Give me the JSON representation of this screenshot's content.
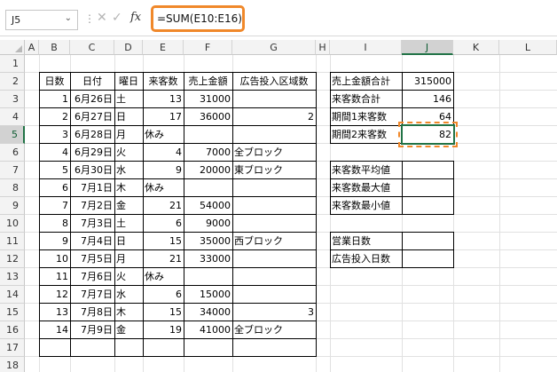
{
  "formula_bar": {
    "name_box": "J5",
    "formula": "=SUM(E10:E16)",
    "fx_label": "fx"
  },
  "columns": [
    "A",
    "B",
    "C",
    "D",
    "E",
    "F",
    "G",
    "H",
    "I",
    "J",
    "K",
    "L"
  ],
  "rows": [
    "1",
    "2",
    "3",
    "4",
    "5",
    "6",
    "7",
    "8",
    "9",
    "10",
    "11",
    "12",
    "13",
    "14",
    "15",
    "16",
    "17",
    "18"
  ],
  "table_headers": {
    "day_num": "日数",
    "date": "日付",
    "weekday": "曜日",
    "visitors": "来客数",
    "sales": "売上金額",
    "ad_area": "広告投入区域数"
  },
  "table_rows": [
    {
      "n": "1",
      "date": "6月26日",
      "wd": "土",
      "visitors": "13",
      "sales": "31000",
      "area": ""
    },
    {
      "n": "2",
      "date": "6月27日",
      "wd": "日",
      "visitors": "17",
      "sales": "36000",
      "area": "2"
    },
    {
      "n": "3",
      "date": "6月28日",
      "wd": "月",
      "visitors": "休み",
      "sales": "",
      "area": ""
    },
    {
      "n": "4",
      "date": "6月29日",
      "wd": "火",
      "visitors": "4",
      "sales": "7000",
      "area": "全ブロック"
    },
    {
      "n": "5",
      "date": "6月30日",
      "wd": "水",
      "visitors": "9",
      "sales": "20000",
      "area": "東ブロック"
    },
    {
      "n": "6",
      "date": "7月1日",
      "wd": "木",
      "visitors": "休み",
      "sales": "",
      "area": ""
    },
    {
      "n": "7",
      "date": "7月2日",
      "wd": "金",
      "visitors": "21",
      "sales": "54000",
      "area": ""
    },
    {
      "n": "8",
      "date": "7月3日",
      "wd": "土",
      "visitors": "6",
      "sales": "9000",
      "area": ""
    },
    {
      "n": "9",
      "date": "7月4日",
      "wd": "日",
      "visitors": "15",
      "sales": "35000",
      "area": "西ブロック"
    },
    {
      "n": "10",
      "date": "7月5日",
      "wd": "月",
      "visitors": "21",
      "sales": "33000",
      "area": ""
    },
    {
      "n": "11",
      "date": "7月6日",
      "wd": "火",
      "visitors": "休み",
      "sales": "",
      "area": ""
    },
    {
      "n": "12",
      "date": "7月7日",
      "wd": "水",
      "visitors": "6",
      "sales": "15000",
      "area": ""
    },
    {
      "n": "13",
      "date": "7月8日",
      "wd": "木",
      "visitors": "15",
      "sales": "34000",
      "area": "3"
    },
    {
      "n": "14",
      "date": "7月9日",
      "wd": "金",
      "visitors": "19",
      "sales": "41000",
      "area": "全ブロック"
    }
  ],
  "summary": {
    "total_sales_label": "売上金額合計",
    "total_sales": "315000",
    "total_visitors_label": "来客数合計",
    "total_visitors": "146",
    "period1_label": "期間1来客数",
    "period1": "64",
    "period2_label": "期間2来客数",
    "period2": "82",
    "avg_label": "来客数平均値",
    "max_label": "来客数最大値",
    "min_label": "来客数最小値",
    "business_days_label": "営業日数",
    "ad_days_label": "広告投入日数"
  },
  "colors": {
    "accent_orange": "#f0882a",
    "selection_green": "#217346"
  }
}
